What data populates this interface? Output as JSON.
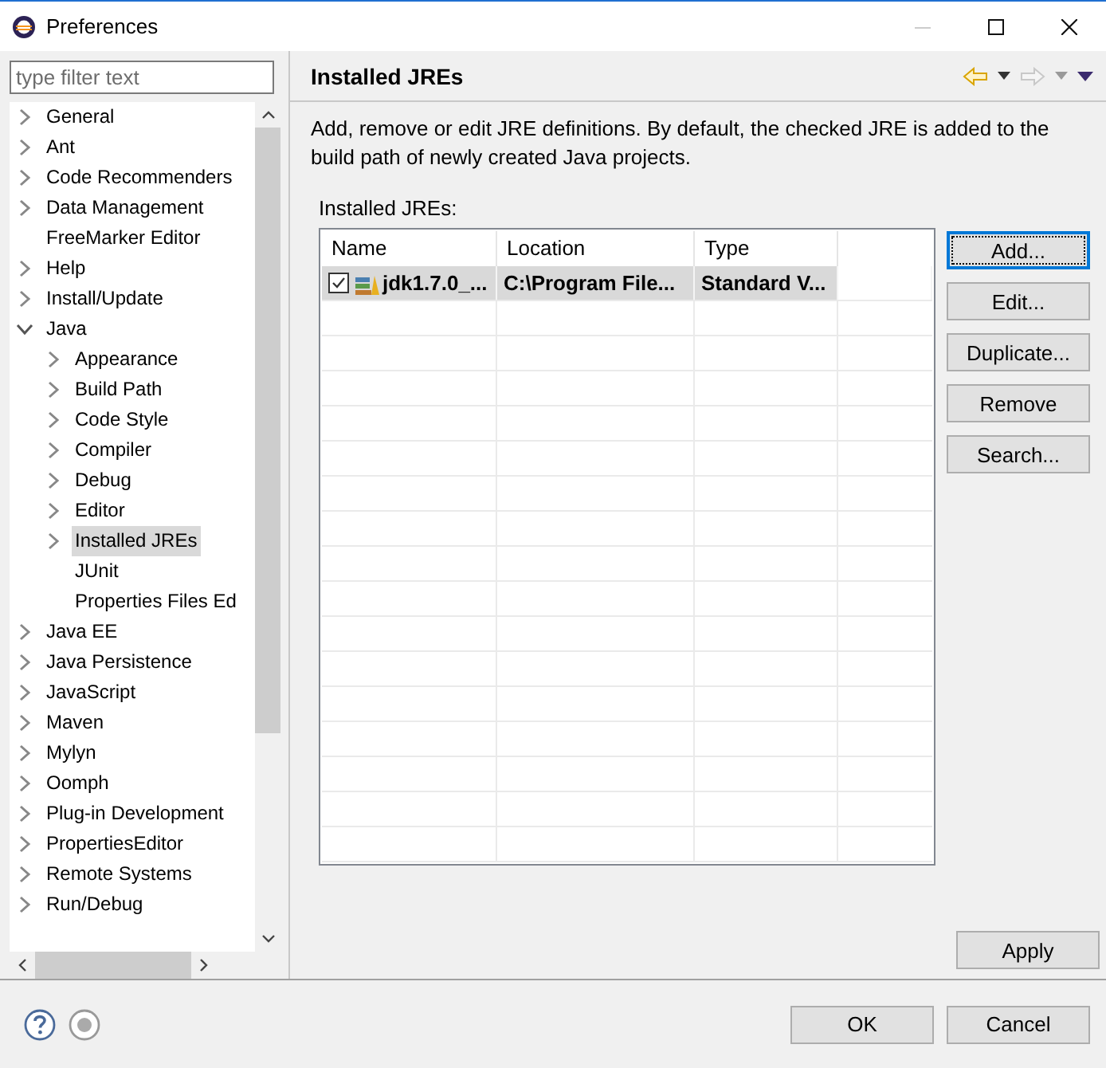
{
  "window": {
    "title": "Preferences"
  },
  "filter": {
    "placeholder": "type filter text"
  },
  "tree": [
    {
      "label": "General",
      "kind": "folder",
      "expanded": false,
      "selected": false
    },
    {
      "label": "Ant",
      "kind": "folder",
      "expanded": false,
      "selected": false
    },
    {
      "label": "Code Recommenders",
      "kind": "folder",
      "expanded": false,
      "selected": false
    },
    {
      "label": "Data Management",
      "kind": "folder",
      "expanded": false,
      "selected": false
    },
    {
      "label": "FreeMarker Editor",
      "kind": "leaf",
      "selected": false
    },
    {
      "label": "Help",
      "kind": "folder",
      "expanded": false,
      "selected": false
    },
    {
      "label": "Install/Update",
      "kind": "folder",
      "expanded": false,
      "selected": false
    },
    {
      "label": "Java",
      "kind": "folder",
      "expanded": true,
      "selected": false,
      "children": [
        {
          "label": "Appearance",
          "kind": "folder",
          "expanded": false,
          "selected": false
        },
        {
          "label": "Build Path",
          "kind": "folder",
          "expanded": false,
          "selected": false
        },
        {
          "label": "Code Style",
          "kind": "folder",
          "expanded": false,
          "selected": false
        },
        {
          "label": "Compiler",
          "kind": "folder",
          "expanded": false,
          "selected": false
        },
        {
          "label": "Debug",
          "kind": "folder",
          "expanded": false,
          "selected": false
        },
        {
          "label": "Editor",
          "kind": "folder",
          "expanded": false,
          "selected": false
        },
        {
          "label": "Installed JREs",
          "kind": "folder",
          "expanded": false,
          "selected": true
        },
        {
          "label": "JUnit",
          "kind": "leaf",
          "selected": false
        },
        {
          "label": "Properties Files Ed",
          "kind": "leaf",
          "selected": false
        }
      ]
    },
    {
      "label": "Java EE",
      "kind": "folder",
      "expanded": false,
      "selected": false
    },
    {
      "label": "Java Persistence",
      "kind": "folder",
      "expanded": false,
      "selected": false
    },
    {
      "label": "JavaScript",
      "kind": "folder",
      "expanded": false,
      "selected": false
    },
    {
      "label": "Maven",
      "kind": "folder",
      "expanded": false,
      "selected": false
    },
    {
      "label": "Mylyn",
      "kind": "folder",
      "expanded": false,
      "selected": false
    },
    {
      "label": "Oomph",
      "kind": "folder",
      "expanded": false,
      "selected": false
    },
    {
      "label": "Plug-in Development",
      "kind": "folder",
      "expanded": false,
      "selected": false
    },
    {
      "label": "PropertiesEditor",
      "kind": "folder",
      "expanded": false,
      "selected": false
    },
    {
      "label": "Remote Systems",
      "kind": "folder",
      "expanded": false,
      "selected": false
    },
    {
      "label": "Run/Debug",
      "kind": "folder",
      "expanded": false,
      "selected": false
    }
  ],
  "page": {
    "title": "Installed JREs",
    "description": "Add, remove or edit JRE definitions. By default, the checked JRE is added to the build path of newly created Java projects.",
    "table_label": "Installed JREs:",
    "table": {
      "columns": [
        "Name",
        "Location",
        "Type"
      ],
      "rows": [
        {
          "checked": true,
          "selected": true,
          "cells": [
            "jdk1.7.0_...",
            "C:\\Program File...",
            "Standard V..."
          ]
        }
      ]
    },
    "buttons": [
      {
        "label": "Add...",
        "focused": true
      },
      {
        "label": "Edit...",
        "focused": false
      },
      {
        "label": "Duplicate...",
        "focused": false
      },
      {
        "label": "Remove",
        "focused": false
      },
      {
        "label": "Search...",
        "focused": false
      }
    ],
    "apply": "Apply"
  },
  "dialog_buttons": [
    "OK",
    "Cancel"
  ]
}
